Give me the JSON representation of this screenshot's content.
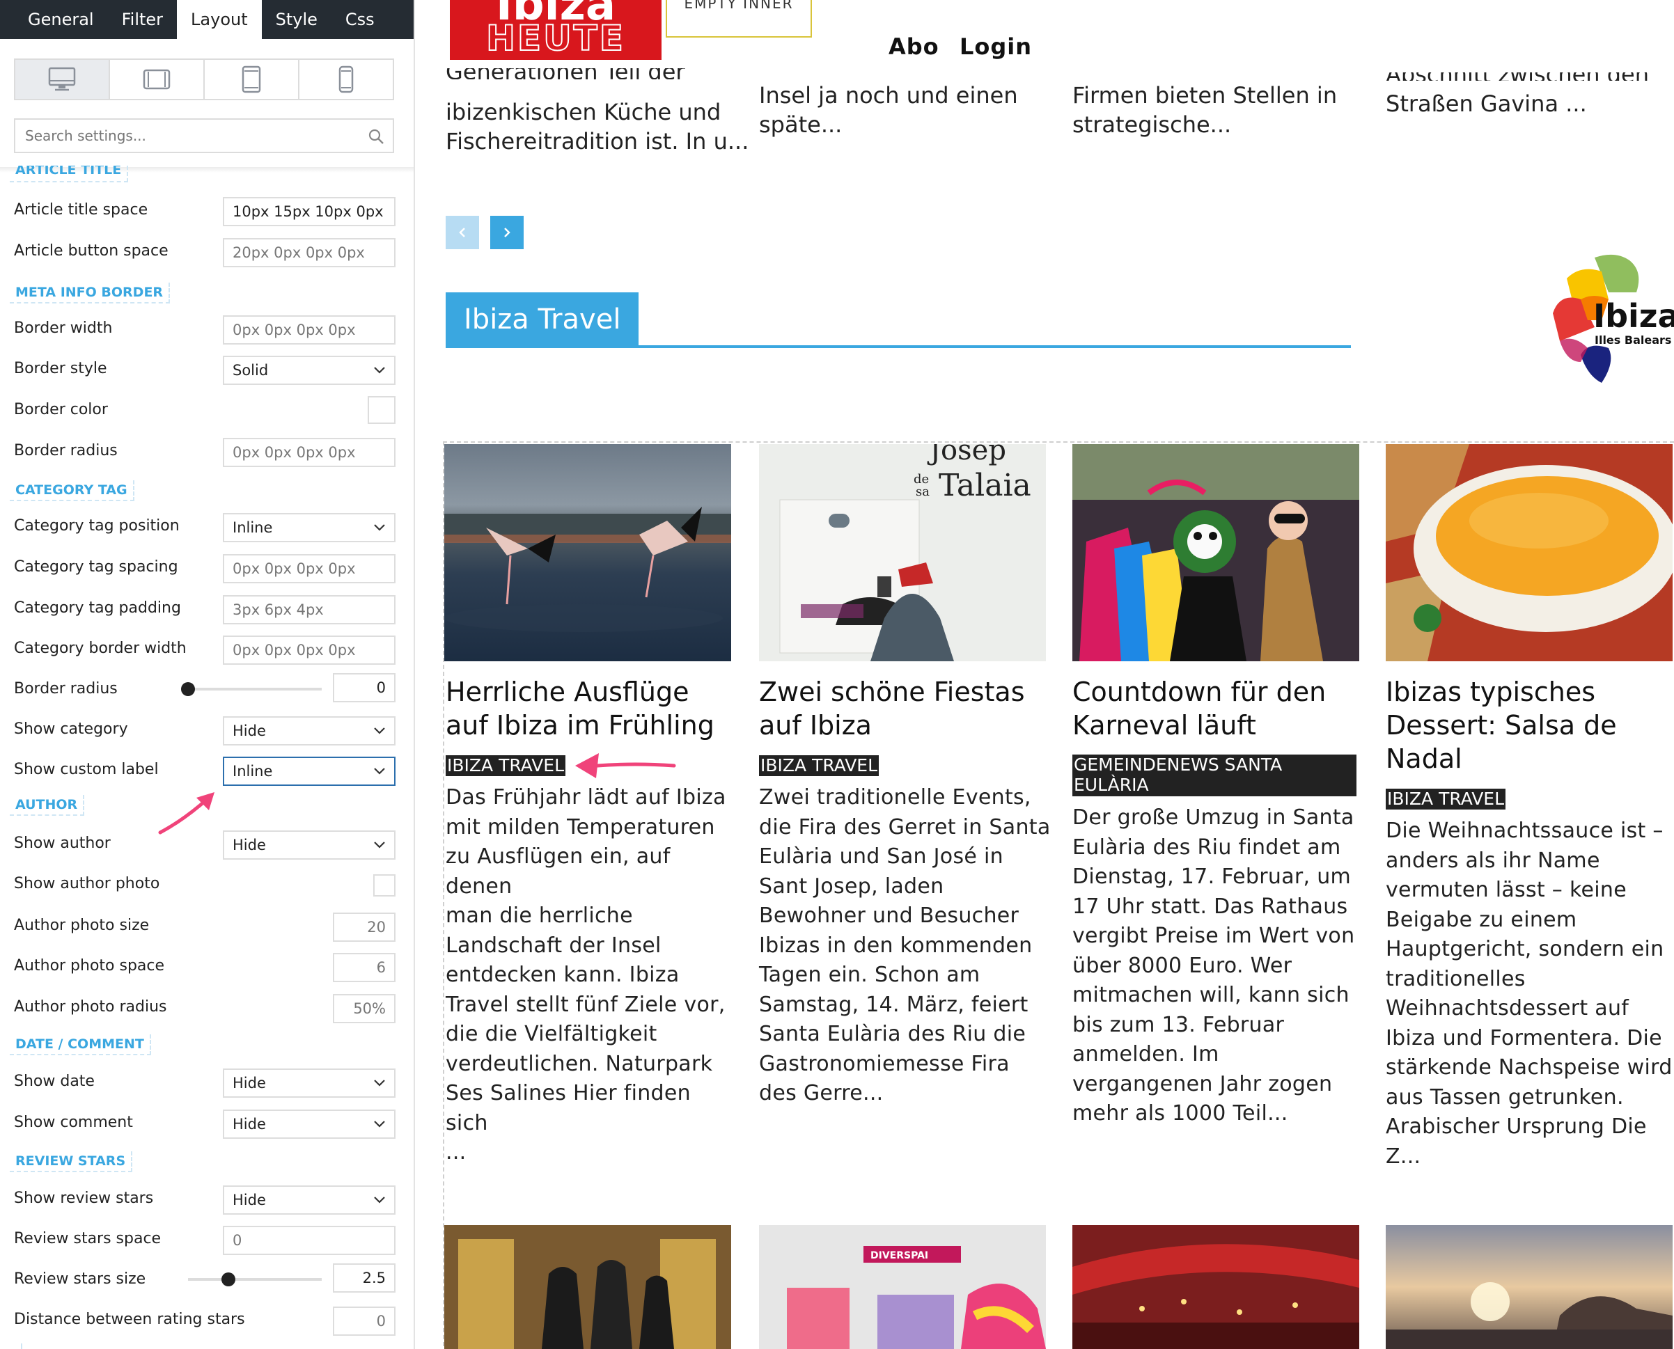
{
  "panel": {
    "tabs": [
      "General",
      "Filter",
      "Layout",
      "Style",
      "Css"
    ],
    "active_tab": "Layout",
    "search_placeholder": "Search settings...",
    "partial_section_top": "ARTICLE TITLE",
    "sections": {
      "meta_info_border": "META INFO BORDER",
      "category_tag": "CATEGORY TAG",
      "author": "AUTHOR",
      "date_comment": "DATE / COMMENT",
      "review_stars": "REVIEW STARS"
    },
    "settings": {
      "article_title_space": {
        "label": "Article title space",
        "value": "10px 15px 10px 0px"
      },
      "article_button_space": {
        "label": "Article button space",
        "placeholder": "20px 0px 0px 0px"
      },
      "border_width": {
        "label": "Border width",
        "placeholder": "0px 0px 0px 0px"
      },
      "border_style": {
        "label": "Border style",
        "value": "Solid"
      },
      "border_color": {
        "label": "Border color"
      },
      "border_radius_meta": {
        "label": "Border radius",
        "placeholder": "0px 0px 0px 0px"
      },
      "category_tag_position": {
        "label": "Category tag position",
        "value": "Inline"
      },
      "category_tag_spacing": {
        "label": "Category tag spacing",
        "placeholder": "0px 0px 0px 0px"
      },
      "category_tag_padding": {
        "label": "Category tag padding",
        "placeholder": "3px 6px 4px"
      },
      "category_border_width": {
        "label": "Category border width",
        "placeholder": "0px 0px 0px 0px"
      },
      "border_radius_cat": {
        "label": "Border radius",
        "value": "0",
        "slider_fraction": 0.0
      },
      "show_category": {
        "label": "Show category",
        "value": "Hide"
      },
      "show_custom_label": {
        "label": "Show custom label",
        "value": "Inline"
      },
      "show_author": {
        "label": "Show author",
        "value": "Hide"
      },
      "show_author_photo": {
        "label": "Show author photo"
      },
      "author_photo_size": {
        "label": "Author photo size",
        "placeholder": "20"
      },
      "author_photo_space": {
        "label": "Author photo space",
        "placeholder": "6"
      },
      "author_photo_radius": {
        "label": "Author photo radius",
        "placeholder": "50%"
      },
      "show_date": {
        "label": "Show date",
        "value": "Hide"
      },
      "show_comment": {
        "label": "Show comment",
        "value": "Hide"
      },
      "show_review_stars": {
        "label": "Show review stars",
        "value": "Hide"
      },
      "review_stars_space": {
        "label": "Review stars space",
        "placeholder": "0"
      },
      "review_stars_size": {
        "label": "Review stars size",
        "value": "2.5",
        "slider_fraction": 0.3
      },
      "distance_between_rating_stars": {
        "label": "Distance between rating stars",
        "placeholder": "0"
      }
    }
  },
  "site": {
    "logo_line1": "Ibiza",
    "logo_line2": "HEUTE",
    "empty_inner": "EMPTY INNER",
    "nav": {
      "abo": "Abo",
      "login": "Login"
    },
    "prev_excerpts": [
      {
        "l0": "Generationen Teil der",
        "l1": "ibizenkischen Küche und",
        "l2": "Fischereitradition ist. In u..."
      },
      {
        "l1": "Insel ja noch und einen",
        "l2": "späte..."
      },
      {
        "l1": "Firmen bieten Stellen in",
        "l2": "strategische..."
      },
      {
        "l0": "Abschnitt zwischen den",
        "l1": "Straßen Gavina ..."
      }
    ],
    "block_title": "Ibiza Travel",
    "side_logo": {
      "name": "Ibiza",
      "sub": "Illes Balears"
    },
    "image2_text": {
      "josep": "Josep",
      "de": "de",
      "sa": "sa",
      "talaia": "Talaia"
    },
    "bottom_sign": "DIVERSPAI",
    "articles": [
      {
        "title_lines": [
          "Herrliche Ausflüge",
          "auf Ibiza im Frühling"
        ],
        "category": "IBIZA TRAVEL",
        "excerpt_lines": [
          "Das Frühjahr lädt auf Ibiza",
          "mit milden Temperaturen",
          "zu Ausflügen ein, auf denen",
          "man die herrliche",
          "Landschaft der Insel",
          "entdecken kann. Ibiza",
          "Travel stellt fünf Ziele vor,",
          "die die Vielfältigkeit",
          "verdeutlichen. Naturpark",
          "Ses Salines Hier finden sich",
          "..."
        ]
      },
      {
        "title_lines": [
          "Zwei schöne Fiestas",
          "auf Ibiza"
        ],
        "category": "IBIZA TRAVEL",
        "excerpt_lines": [
          "Zwei traditionelle Events,",
          "die Fira des Gerret in Santa",
          "Eulària und San José in",
          "Sant Josep, laden",
          "Bewohner und Besucher",
          "Ibizas in den kommenden",
          "Tagen ein. Schon am",
          "Samstag, 14. März, feiert",
          "Santa Eulària des Riu die",
          "Gastronomiemesse Fira",
          "des Gerre..."
        ]
      },
      {
        "title_lines": [
          "Countdown für den",
          "Karneval läuft"
        ],
        "category_lines": [
          "GEMEINDENEWS SANTA",
          "EULÀRIA"
        ],
        "excerpt_lines": [
          "Der große Umzug in Santa",
          "Eulària des Riu findet am",
          "Dienstag, 17. Februar, um",
          "17 Uhr statt. Das Rathaus",
          "vergibt Preise im Wert von",
          "über 8000 Euro. Wer",
          "mitmachen will, kann sich",
          "bis zum 13. Februar",
          "anmelden. Im",
          "vergangenen Jahr zogen",
          "mehr als 1000 Teil..."
        ]
      },
      {
        "title_lines": [
          "Ibizas typisches",
          "Dessert: Salsa de",
          "Nadal"
        ],
        "category": "IBIZA TRAVEL",
        "excerpt_lines": [
          "Die Weihnachtssauce ist –",
          "anders als ihr Name",
          "vermuten lässt – keine",
          "Beigabe zu einem",
          "Hauptgericht, sondern ein",
          "traditionelles",
          "Weihnachtsdessert auf",
          "Ibiza und Formentera. Die",
          "stärkende Nachspeise wird",
          "aus Tassen getrunken.",
          "Arabischer Ursprung Die",
          "Z..."
        ]
      }
    ]
  },
  "colors": {
    "accent_blue": "#3aa7e0",
    "annotation_pink": "#f0437a",
    "logo_red": "#d8171d",
    "tab_bar": "#252c33"
  }
}
